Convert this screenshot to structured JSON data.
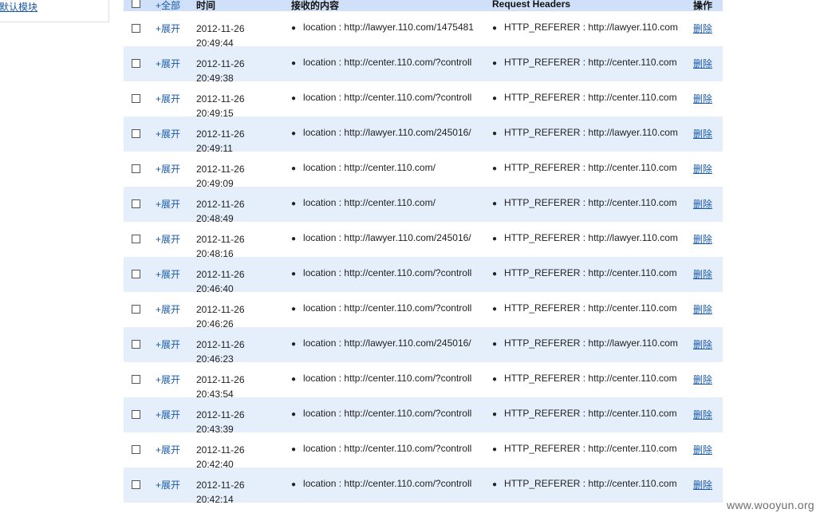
{
  "sidebar": {
    "link_label": "默认模块"
  },
  "table": {
    "headers": {
      "expand_all": "+全部",
      "time": "时间",
      "content": "接收的内容",
      "request_headers": "Request Headers",
      "actions": "操作"
    },
    "bullet": "●",
    "expand_label": "+展开",
    "delete_label": "删除",
    "rows": [
      {
        "date": "2012-11-26",
        "time": "20:49:44",
        "content": "location : http://lawyer.110.com/1475481",
        "headers": "HTTP_REFERER : http://lawyer.110.com"
      },
      {
        "date": "2012-11-26",
        "time": "20:49:38",
        "content": "location : http://center.110.com/?controll",
        "headers": "HTTP_REFERER : http://center.110.com"
      },
      {
        "date": "2012-11-26",
        "time": "20:49:15",
        "content": "location : http://center.110.com/?controll",
        "headers": "HTTP_REFERER : http://center.110.com"
      },
      {
        "date": "2012-11-26",
        "time": "20:49:11",
        "content": "location : http://lawyer.110.com/245016/",
        "headers": "HTTP_REFERER : http://lawyer.110.com"
      },
      {
        "date": "2012-11-26",
        "time": "20:49:09",
        "content": "location : http://center.110.com/",
        "headers": "HTTP_REFERER : http://center.110.com"
      },
      {
        "date": "2012-11-26",
        "time": "20:48:49",
        "content": "location : http://center.110.com/",
        "headers": "HTTP_REFERER : http://center.110.com"
      },
      {
        "date": "2012-11-26",
        "time": "20:48:16",
        "content": "location : http://lawyer.110.com/245016/",
        "headers": "HTTP_REFERER : http://lawyer.110.com"
      },
      {
        "date": "2012-11-26",
        "time": "20:46:40",
        "content": "location : http://center.110.com/?controll",
        "headers": "HTTP_REFERER : http://center.110.com"
      },
      {
        "date": "2012-11-26",
        "time": "20:46:26",
        "content": "location : http://center.110.com/?controll",
        "headers": "HTTP_REFERER : http://center.110.com"
      },
      {
        "date": "2012-11-26",
        "time": "20:46:23",
        "content": "location : http://lawyer.110.com/245016/",
        "headers": "HTTP_REFERER : http://lawyer.110.com"
      },
      {
        "date": "2012-11-26",
        "time": "20:43:54",
        "content": "location : http://center.110.com/?controll",
        "headers": "HTTP_REFERER : http://center.110.com"
      },
      {
        "date": "2012-11-26",
        "time": "20:43:39",
        "content": "location : http://center.110.com/?controll",
        "headers": "HTTP_REFERER : http://center.110.com"
      },
      {
        "date": "2012-11-26",
        "time": "20:42:40",
        "content": "location : http://center.110.com/?controll",
        "headers": "HTTP_REFERER : http://center.110.com"
      },
      {
        "date": "2012-11-26",
        "time": "20:42:14",
        "content": "location : http://center.110.com/?controll",
        "headers": "HTTP_REFERER : http://center.110.com"
      }
    ]
  },
  "watermark": "www.wooyun.org",
  "colors": {
    "link": "#1a5aa6",
    "header_bg": "#cfe0f8",
    "alt_row_bg": "#e5eefb"
  }
}
